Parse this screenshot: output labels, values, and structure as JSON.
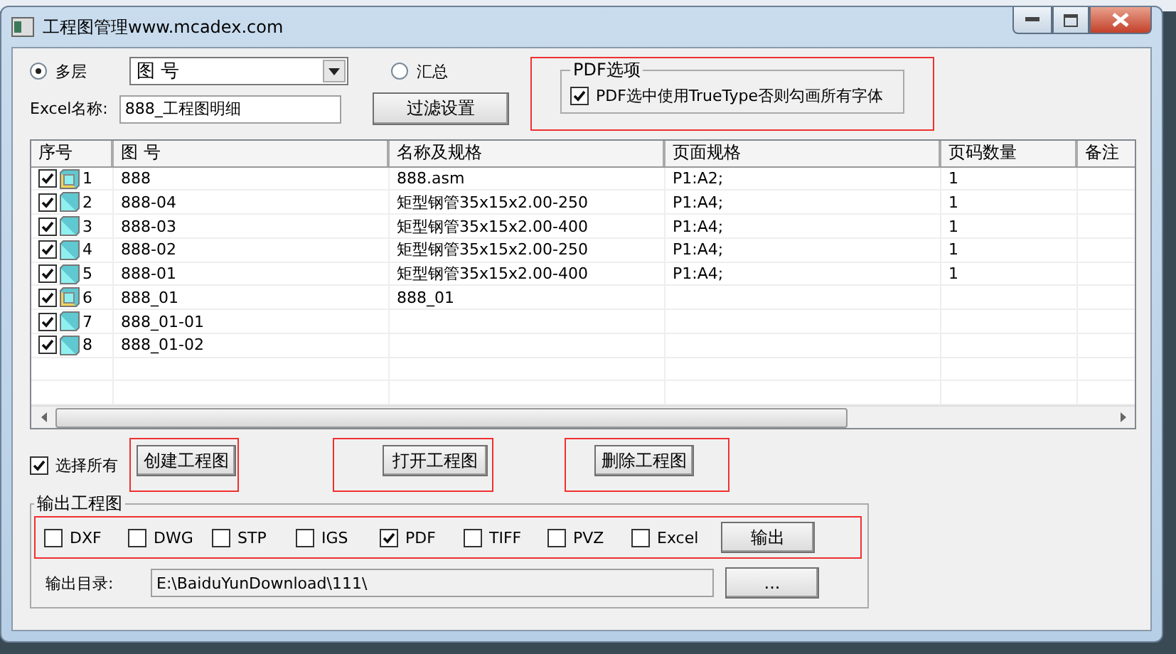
{
  "window": {
    "title": "工程图管理www.mcadex.com"
  },
  "mode_options": [
    {
      "label": "多层",
      "selected": true
    },
    {
      "label": "汇总",
      "selected": false
    }
  ],
  "sort_field": {
    "value": "图 号"
  },
  "excel_name": {
    "label": "Excel名称:",
    "value": "888_工程图明细"
  },
  "filter_button": {
    "label": "过滤设置"
  },
  "pdf_options": {
    "title": "PDF选项",
    "highlighted": true,
    "option": {
      "label": "PDF选中使用TrueType否则勾画所有字体",
      "checked": true
    }
  },
  "table": {
    "columns": [
      "序号",
      "图 号",
      "名称及规格",
      "页面规格",
      "页码数量",
      "备注"
    ],
    "rows": [
      {
        "checked": true,
        "kind": "assembly",
        "cells": [
          "1",
          "888",
          "888.asm",
          "P1:A2;",
          "1"
        ]
      },
      {
        "checked": true,
        "kind": "part",
        "cells": [
          "2",
          "888-04",
          "矩型钢管35x15x2.00-250",
          "P1:A4;",
          "1"
        ]
      },
      {
        "checked": true,
        "kind": "part",
        "cells": [
          "3",
          "888-03",
          "矩型钢管35x15x2.00-400",
          "P1:A4;",
          "1"
        ]
      },
      {
        "checked": true,
        "kind": "part",
        "cells": [
          "4",
          "888-02",
          "矩型钢管35x15x2.00-250",
          "P1:A4;",
          "1"
        ]
      },
      {
        "checked": true,
        "kind": "part",
        "cells": [
          "5",
          "888-01",
          "矩型钢管35x15x2.00-400",
          "P1:A4;",
          "1"
        ]
      },
      {
        "checked": true,
        "kind": "assembly",
        "cells": [
          "6",
          "888_01",
          "888_01",
          "",
          ""
        ]
      },
      {
        "checked": true,
        "kind": "part",
        "cells": [
          "7",
          "888_01-01",
          "",
          "",
          ""
        ]
      },
      {
        "checked": true,
        "kind": "part",
        "cells": [
          "8",
          "888_01-02",
          "",
          "",
          ""
        ]
      }
    ]
  },
  "select_all": {
    "label": "选择所有",
    "checked": true
  },
  "action_buttons": [
    {
      "label": "创建工程图",
      "highlighted": true
    },
    {
      "label": "打开工程图",
      "highlighted": true
    },
    {
      "label": "删除工程图",
      "highlighted": true
    }
  ],
  "output": {
    "title": "输出工程图",
    "highlighted": true,
    "formats": [
      {
        "label": "DXF",
        "checked": false
      },
      {
        "label": "DWG",
        "checked": false
      },
      {
        "label": "STP",
        "checked": false
      },
      {
        "label": "IGS",
        "checked": false
      },
      {
        "label": "PDF",
        "checked": true
      },
      {
        "label": "TIFF",
        "checked": false
      },
      {
        "label": "PVZ",
        "checked": false
      },
      {
        "label": "Excel",
        "checked": false
      }
    ],
    "export_button": "输出",
    "directory": {
      "label": "输出目录:",
      "value": "E:\\BaiduYunDownload\\111\\"
    },
    "browse_button": "..."
  }
}
